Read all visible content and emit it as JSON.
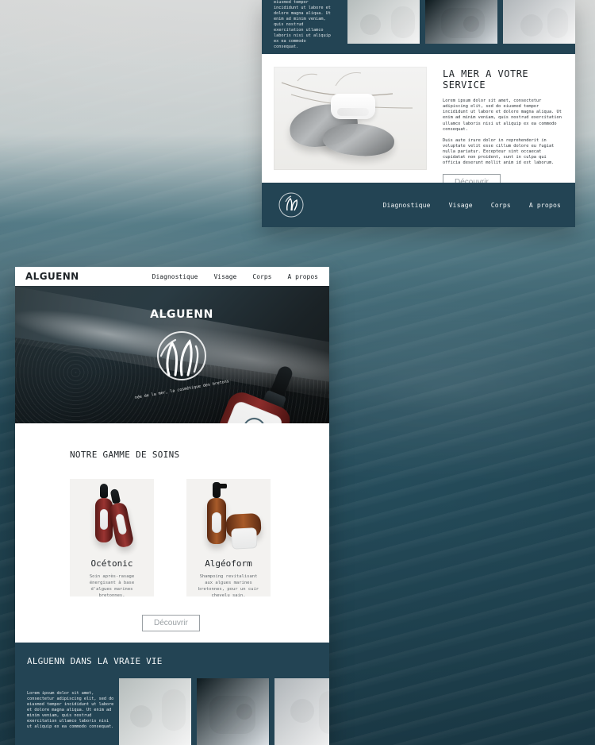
{
  "top_mock": {
    "strip_text": "eiusmod tempor incididunt ut labore et dolore magna aliqua. Ut enim ad minim veniam, quis nostrud exercitation ullamco laboris nisi ut aliquip ex ea commodo consequat.",
    "section_title": "LA MER A VOTRE SERVICE",
    "paragraph_1": "Lorem ipsum dolor sit amet, consectetur adipiscing elit, sed do eiusmod tempor incididunt ut labore et dolore magna aliqua. Ut enim ad minim veniam, quis nostrud exercitation ullamco laboris nisi ut aliquip ex ea commodo consequat.",
    "paragraph_2": "Duis aute irure dolor in reprehenderit in voluptate velit esse cillum dolore eu fugiat nulla pariatur. Excepteur sint occaecat cupidatat non proident, sunt in culpa qui officia deserunt mollit anim id est laborum.",
    "button_label": "Découvrir",
    "nav": [
      "Diagnostique",
      "Visage",
      "Corps",
      "A propos"
    ]
  },
  "main_mock": {
    "brand": "ALGUENN",
    "nav": [
      "Diagnostique",
      "Visage",
      "Corps",
      "A propos"
    ],
    "hero": {
      "logo_text": "ALGUENN",
      "tagline": "née de la mer, la cosmétique des bretons"
    },
    "section_title": "NOTRE GAMME DE SOINS",
    "products": [
      {
        "name": "Océtonic",
        "description": "Soin après-rasage énergisant à base d'algues marines bretonnes."
      },
      {
        "name": "Algéoform",
        "description": "Shampoing revitalisant aux algues marines bretonnes, pour un cuir chevelu sain."
      }
    ],
    "discover_button": "Découvrir",
    "lower_section": {
      "title": "ALGUENN DANS LA VRAIE VIE",
      "text": "Lorem ipsum dolor sit amet, consectetur adipiscing elit, sed do eiusmod tempor incididunt ut labore et dolore magna aliqua. Ut enim ad minim veniam, quis nostrud exercitation ullamco laboris nisi ut aliquip ex ea commodo consequat."
    }
  },
  "colors": {
    "navy": "#234454",
    "offwhite": "#f3f2f0"
  }
}
